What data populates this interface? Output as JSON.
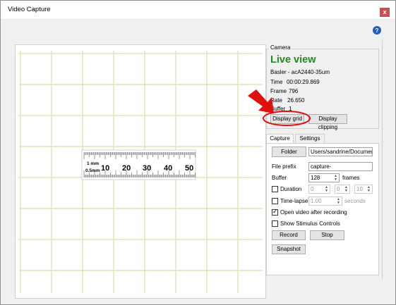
{
  "window": {
    "title": "Video Capture",
    "close_label": "x"
  },
  "help_icon_label": "?",
  "camera": {
    "group_label": "Camera",
    "live_view": "Live view",
    "model": "Basler - acA2440-35um",
    "time_label": "Time",
    "time_value": "00:00:29.869",
    "frame_label": "Frame",
    "frame_value": "796",
    "rate_label": "Rate",
    "rate_value": "26.650",
    "buffer_label": "Buffer",
    "buffer_value": "1",
    "display_grid_label": "Display grid",
    "display_clipping_label": "Display clipping"
  },
  "tabs": [
    {
      "label": "Capture",
      "active": true
    },
    {
      "label": "Settings",
      "active": false
    }
  ],
  "capture": {
    "folder_button": "Folder",
    "folder_path": "Users/sandrine/Documents",
    "file_prefix_label": "File prefix",
    "file_prefix_value": "capture-",
    "buffer_label": "Buffer",
    "buffer_value": "128",
    "buffer_unit": "frames",
    "duration_label": "Duration",
    "duration_h": "0",
    "duration_m": "0",
    "duration_s": "10",
    "duration_sep": ":",
    "timelapse_label": "Time-lapse",
    "timelapse_value": "1.00",
    "timelapse_unit": "seconds",
    "open_video_label": "Open video after recording",
    "open_video_checked": true,
    "stimulus_label": "Show Stimulus Controls",
    "stimulus_checked": false,
    "record_button": "Record",
    "stop_button": "Stop",
    "snapshot_button": "Snapshot"
  },
  "ruler": {
    "unit_top": "1 mm",
    "unit_bottom": "0.5mm",
    "tick_labels": [
      "10",
      "20",
      "30",
      "40",
      "50"
    ]
  },
  "colors": {
    "live_view": "#1f8c1f",
    "annotation": "#e01010",
    "grid_line": "#dde6b8"
  }
}
